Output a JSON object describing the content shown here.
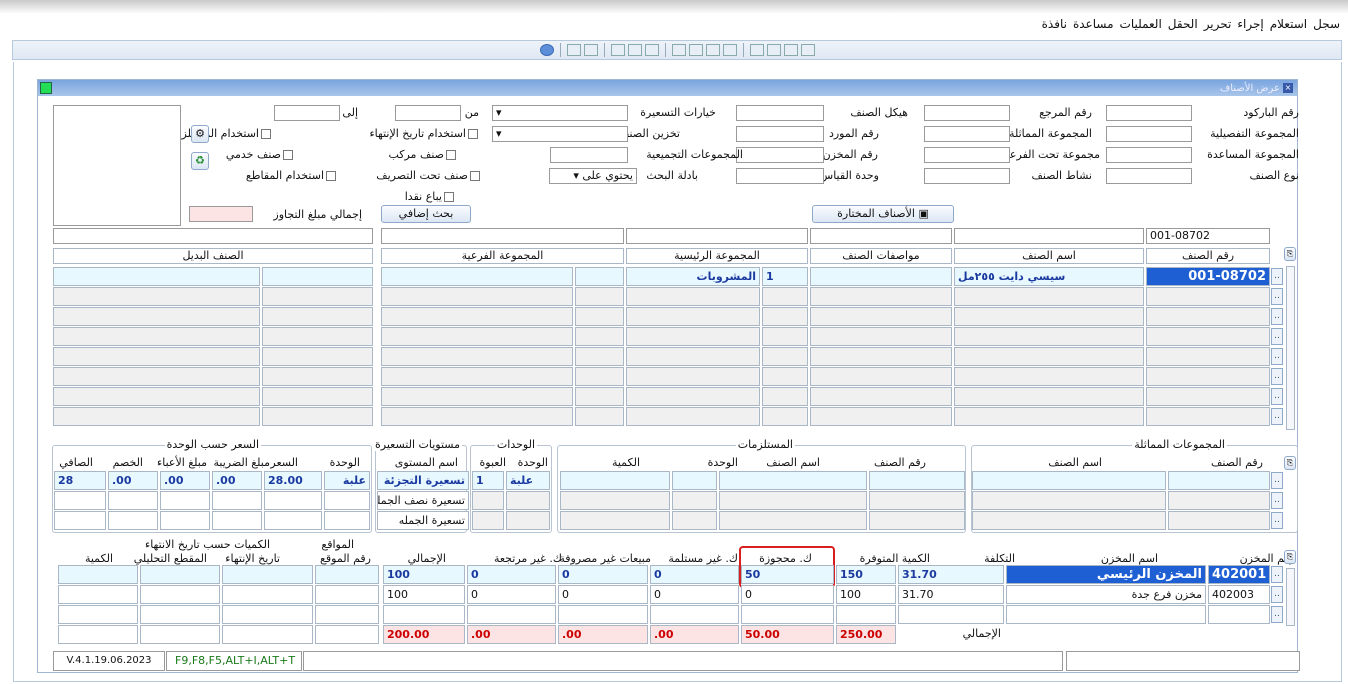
{
  "menu": [
    "سجل",
    "استعلام",
    "إجراء",
    "تحرير",
    "الحقل",
    "العمليات",
    "مساعدة",
    "نافذة"
  ],
  "window": {
    "title": "عرض الأصناف"
  },
  "filters": {
    "barcode": "رقم الباركود",
    "ref_no": "رقم المرجع",
    "item_structure": "هيكل الصنف",
    "pricing_options": "خيارات التسعيرة",
    "from": "من",
    "to": "إلى",
    "detail_group": "المجموعة التفصيلية",
    "similar_group": "المجموعة المماثلة",
    "supplier_no": "رقم المورد",
    "item_storage": "تخزين الصنف",
    "assist_group": "المجموعة المساعدة",
    "subgroup": "مجموعة تحت الفرعية",
    "store_no": "رقم المخزن",
    "aggregate_groups": "المجموعات التجميعية",
    "item_type": "نوع الصنف",
    "item_activity": "نشاط الصنف",
    "measure_unit": "وحدة القياس",
    "search_method": "بادلة البحث",
    "contains": "يحتوي على",
    "use_expiry": "استخدام تاريخ الإنتهاء",
    "use_requirements": "استخدام المستلزمات",
    "compound_item": "صنف مركب",
    "service_item": "صنف خدمي",
    "under_process": "صنف تحت التصريف",
    "use_sections": "استخدام المقاطع",
    "cash_sold": "يباع نقدا",
    "extra_search": "بحث إضافي",
    "exceed_total": "إجمالي مبلغ التجاوز",
    "selected_items": "الأصناف المختارة"
  },
  "items": {
    "search_item_no": "001-08702",
    "headers": {
      "item_no": "رقم الصنف",
      "item_name": "اسم الصنف",
      "specs": "مواصفات الصنف",
      "main_group": "المجموعة الرئيسية",
      "sub_group": "المجموعة الفرعية",
      "alt_item": "الصنف البديل"
    },
    "row": {
      "item_no": "001-08702",
      "item_name": "سيسي دايت ٢٥٥مل",
      "main_group_no": "1",
      "main_group_name": "المشروبات"
    }
  },
  "similar": {
    "title": "المجموعات المماثلة",
    "item_no": "رقم الصنف",
    "item_name": "اسم الصنف"
  },
  "requirements": {
    "title": "المستلزمات",
    "item_no": "رقم الصنف",
    "item_name": "اسم الصنف",
    "unit": "الوحدة",
    "qty": "الكمية"
  },
  "units": {
    "title": "الوحدات",
    "unit": "الوحدة",
    "pack": "العبوة",
    "row_unit": "علبة",
    "row_pack": "1"
  },
  "levels": {
    "title": "مستويات التسعيرة",
    "name": "اسم المستوى",
    "rows": [
      "تسعيرة التجزئة",
      "تسعيرة نصف الجملة",
      "تسعيرة الجمله"
    ]
  },
  "price": {
    "title": "السعر حسب الوحدة",
    "unit": "الوحدة",
    "price": "السعر",
    "tax": "مبلغ الضريبة",
    "charges": "مبلغ الأعباء",
    "discount": "الخصم",
    "net": "الصافي",
    "row": {
      "unit": "علبة",
      "price": "28.00",
      "tax": ".00",
      "charges": ".00",
      "discount": ".00",
      "net": "28"
    }
  },
  "stores": {
    "headers": {
      "store_no": "رقم المخزن",
      "store_name": "اسم المخزن",
      "cost": "التكلفة",
      "available": "الكمية المتوفرة",
      "reserved": "ك. محجوزة",
      "unreceived": "ك. غير مستلمة",
      "unspent_sales": "مبيعات غير مصروفة",
      "unreturned": "ك. غير مرتجعة",
      "total": "الإجمالي"
    },
    "rows": [
      {
        "store_no": "402001",
        "store_name": "المخزن الرئيسي",
        "cost": "31.70",
        "available": "150",
        "reserved": "50",
        "unreceived": "0",
        "unspent_sales": "0",
        "unreturned": "0",
        "total": "100"
      },
      {
        "store_no": "402003",
        "store_name": "مخزن فرع جدة",
        "cost": "31.70",
        "available": "100",
        "reserved": "0",
        "unreceived": "0",
        "unspent_sales": "0",
        "unreturned": "0",
        "total": "100"
      }
    ],
    "totals_label": "الإجمالي",
    "totals": {
      "available": "250.00",
      "reserved": "50.00",
      "unreceived": ".00",
      "unspent_sales": ".00",
      "unreturned": ".00",
      "total": "200.00"
    }
  },
  "locations": {
    "title": "المواقع",
    "loc_no": "رقم الموقع"
  },
  "expiry": {
    "title": "الكميات حسب تاريخ الانتهاء",
    "expiry_date": "تاريخ الإنتهاء",
    "section": "المقطع التحليلي",
    "qty": "الكمية"
  },
  "status": {
    "version": "V.4.1.19.06.2023",
    "shortcuts": "F9,F8,F5,ALT+I,ALT+T"
  },
  "colors": {
    "accent": "#1f5fd4",
    "highlight": "#d81e1e"
  }
}
